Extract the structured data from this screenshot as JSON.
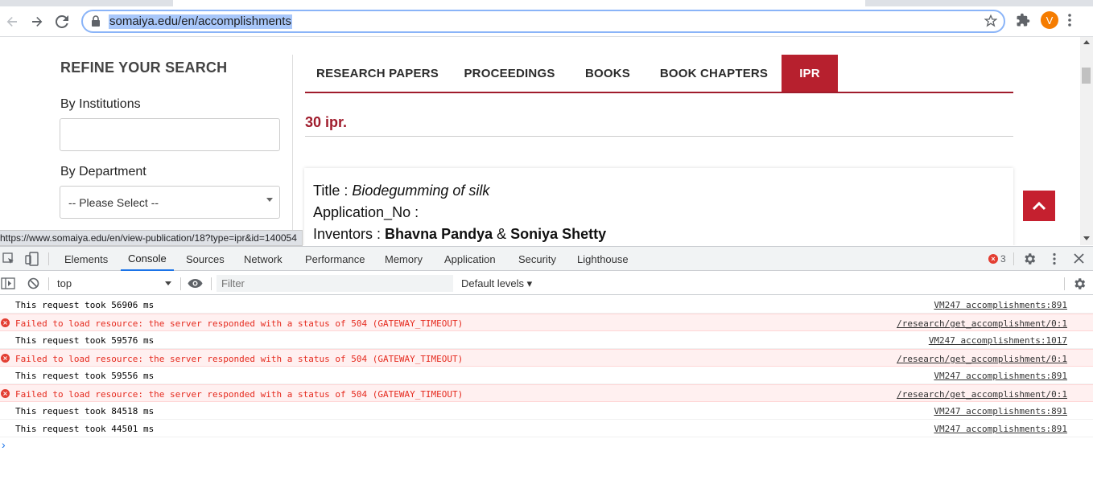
{
  "browser": {
    "url": "somaiya.edu/en/accomplishments",
    "avatar_letter": "V",
    "accent": "#1a73e8"
  },
  "sidebar": {
    "title": "REFINE YOUR SEARCH",
    "by_institutions_label": "By Institutions",
    "by_department_label": "By Department",
    "department_selected": "-- Please Select --"
  },
  "tabs": [
    {
      "label": "RESEARCH PAPERS",
      "active": false
    },
    {
      "label": "PROCEEDINGS",
      "active": false
    },
    {
      "label": "BOOKS",
      "active": false
    },
    {
      "label": "BOOK CHAPTERS",
      "active": false
    },
    {
      "label": "IPR",
      "active": true
    }
  ],
  "result_count": "30 ipr.",
  "card": {
    "title_label": "Title : ",
    "title_value": "Biodegumming of silk",
    "app_no_label": "Application_No :",
    "inventors_label": "Inventors : ",
    "inventor_1": "Bhavna Pandya",
    "inventor_sep": " & ",
    "inventor_2": "Soniya Shetty"
  },
  "status_url": "https://www.somaiya.edu/en/view-publication/18?type=ipr&id=140054",
  "brand_color": "#b7202e",
  "devtools": {
    "tabs": [
      "Elements",
      "Console",
      "Sources",
      "Network",
      "Performance",
      "Memory",
      "Application",
      "Security",
      "Lighthouse"
    ],
    "active_tab": "Console",
    "error_count": "3",
    "context": "top",
    "filter_placeholder": "Filter",
    "levels": "Default levels ▾",
    "messages": [
      {
        "type": "log",
        "text": "This request took 56906 ms",
        "source": "VM247 accomplishments:891"
      },
      {
        "type": "error",
        "text": "Failed to load resource: the server responded with a status of 504 (GATEWAY_TIMEOUT)",
        "source": "/research/get_accomplishment/0:1"
      },
      {
        "type": "log",
        "text": "This request took 59576 ms",
        "source": "VM247 accomplishments:1017"
      },
      {
        "type": "error",
        "text": "Failed to load resource: the server responded with a status of 504 (GATEWAY_TIMEOUT)",
        "source": "/research/get_accomplishment/0:1"
      },
      {
        "type": "log",
        "text": "This request took 59556 ms",
        "source": "VM247 accomplishments:891"
      },
      {
        "type": "error",
        "text": "Failed to load resource: the server responded with a status of 504 (GATEWAY_TIMEOUT)",
        "source": "/research/get_accomplishment/0:1"
      },
      {
        "type": "log",
        "text": "This request took 84518 ms",
        "source": "VM247 accomplishments:891"
      },
      {
        "type": "log",
        "text": "This request took 44501 ms",
        "source": "VM247 accomplishments:891"
      }
    ],
    "prompt_glyph": "›"
  }
}
